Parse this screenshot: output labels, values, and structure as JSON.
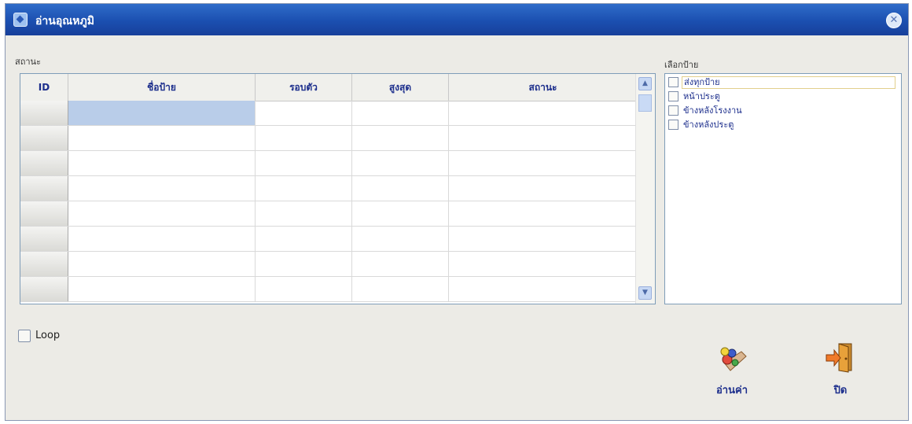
{
  "window": {
    "title": "อ่านอุณหภูมิ"
  },
  "titlebar": {
    "close_glyph": "✕"
  },
  "status_label": "สถานะ",
  "grid": {
    "columns": [
      "ID",
      "ชื่อป้าย",
      "รอบตัว",
      "สูงสุด",
      "สถานะ"
    ],
    "rows": [
      [
        "",
        "",
        "",
        "",
        ""
      ],
      [
        "",
        "",
        "",
        "",
        ""
      ],
      [
        "",
        "",
        "",
        "",
        ""
      ],
      [
        "",
        "",
        "",
        "",
        ""
      ],
      [
        "",
        "",
        "",
        "",
        ""
      ],
      [
        "",
        "",
        "",
        "",
        ""
      ],
      [
        "",
        "",
        "",
        "",
        ""
      ],
      [
        "",
        "",
        "",
        "",
        ""
      ]
    ],
    "scroll_up": "▲",
    "scroll_down": "▼"
  },
  "select_label": "เลือกป้าย",
  "tag_list": [
    {
      "label": "ส่งทุกป้าย",
      "checked": false
    },
    {
      "label": "หน้าประตู",
      "checked": false
    },
    {
      "label": "ข้างหลังโรงงาน",
      "checked": false
    },
    {
      "label": "ข้างหลังประตู",
      "checked": false
    }
  ],
  "loop_label": "Loop",
  "loop_checked": false,
  "buttons": {
    "read_label": "อ่านค่า",
    "close_label": "ปิด"
  },
  "colors": {
    "title_bar": "#1b4fb0",
    "selection": "#b9cde9",
    "text_accent": "#1c2e8c",
    "window_bg": "#ecebe6"
  }
}
